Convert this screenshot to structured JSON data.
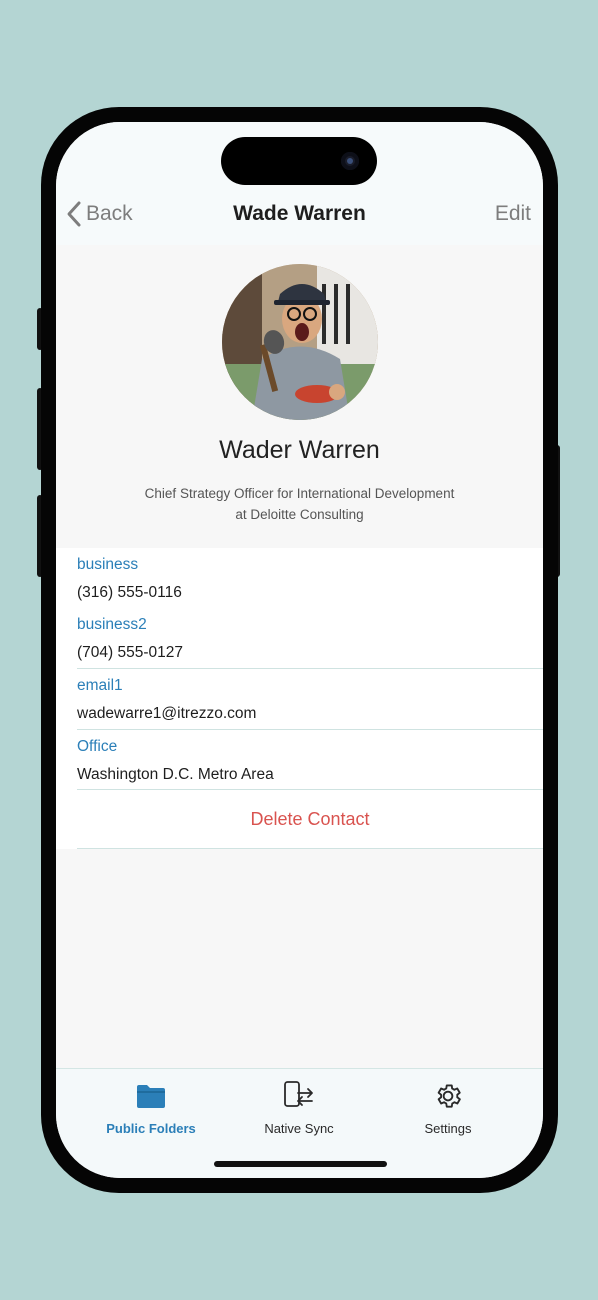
{
  "nav": {
    "back_label": "Back",
    "title": "Wade Warren",
    "edit_label": "Edit"
  },
  "profile": {
    "name": "Wader Warren",
    "title_line1": "Chief Strategy Officer for International Development",
    "title_line2": "at Deloitte Consulting"
  },
  "fields": [
    {
      "label": "business",
      "value": "(316) 555-0116"
    },
    {
      "label": "business2",
      "value": "(704) 555-0127"
    },
    {
      "label": "email1",
      "value": "wadewarre1@itrezzo.com"
    },
    {
      "label": "Office",
      "value": "Washington D.C. Metro Area"
    }
  ],
  "delete_label": "Delete Contact",
  "tabs": [
    {
      "label": "Public Folders",
      "icon": "folder-icon",
      "active": true
    },
    {
      "label": "Native Sync",
      "icon": "phone-sync-icon",
      "active": false
    },
    {
      "label": "Settings",
      "icon": "gear-icon",
      "active": false
    }
  ],
  "colors": {
    "accent": "#2b7fb8",
    "destructive": "#d9534f",
    "background": "#b4d5d3"
  }
}
